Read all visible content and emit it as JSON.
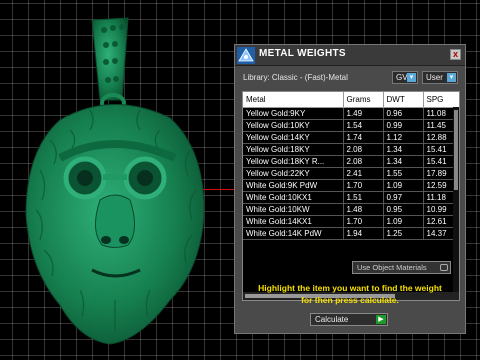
{
  "panel": {
    "title": "METAL WEIGHTS",
    "close_glyph": "x",
    "library_label": "Library: Classic - (Fast)-Metal",
    "gv_label": "GV",
    "user_label": "User",
    "table": {
      "headers": [
        "Metal",
        "Grams",
        "DWT",
        "SPG"
      ],
      "rows": [
        [
          "Yellow Gold:9KY",
          "1.49",
          "0.96",
          "11.08"
        ],
        [
          "Yellow Gold:10KY",
          "1.54",
          "0.99",
          "11.45"
        ],
        [
          "Yellow Gold:14KY",
          "1.74",
          "1.12",
          "12.88"
        ],
        [
          "Yellow Gold:18KY",
          "2.08",
          "1.34",
          "15.41"
        ],
        [
          "Yellow Gold:18KY R...",
          "2.08",
          "1.34",
          "15.41"
        ],
        [
          "Yellow Gold:22KY",
          "2.41",
          "1.55",
          "17.89"
        ],
        [
          "White Gold:9K PdW",
          "1.70",
          "1.09",
          "12.59"
        ],
        [
          "White Gold:10KX1",
          "1.51",
          "0.97",
          "11.18"
        ],
        [
          "White Gold:10KW",
          "1.48",
          "0.95",
          "10.99"
        ],
        [
          "White Gold:14KX1",
          "1.70",
          "1.09",
          "12.61"
        ],
        [
          "White Gold:14K PdW",
          "1.94",
          "1.25",
          "14.37"
        ]
      ]
    },
    "use_object_materials": "Use Object Materials",
    "hint_line1": "Highlight the item you want to find the weight",
    "hint_line2": "for then press calculate.",
    "calculate_label": "Calculate"
  },
  "colors": {
    "model_green": "#1e8c5a",
    "hint_yellow": "#f6e100",
    "panel_bg": "#4a4a4a"
  }
}
